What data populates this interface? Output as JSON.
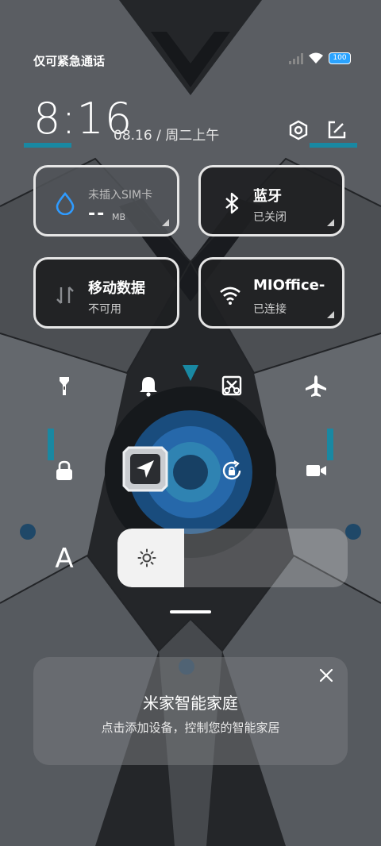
{
  "status_bar": {
    "carrier_text": "仅可紧急通话",
    "battery_text": "100",
    "icons": [
      "signal-icon",
      "wifi-icon",
      "battery-icon"
    ]
  },
  "header": {
    "time": "8:16",
    "date": "08.16 / 周二上午",
    "actions": [
      "settings-icon",
      "edit-icon"
    ]
  },
  "tiles": {
    "sim": {
      "label": "未插入SIM卡",
      "value": "--",
      "unit": "MB",
      "icon": "water-drop-icon",
      "accent": "#2f9bff"
    },
    "bluetooth": {
      "label": "蓝牙",
      "status": "已关闭",
      "icon": "bluetooth-icon"
    },
    "mobile_data": {
      "label": "移动数据",
      "status": "不可用",
      "icon": "data-arrows-icon"
    },
    "wifi": {
      "label": "MIOffice-",
      "status": "已连接",
      "icon": "wifi-icon"
    }
  },
  "toggles_row1": [
    "flashlight-icon",
    "bell-icon",
    "screenshot-icon",
    "airplane-icon"
  ],
  "toggles_row2": [
    "lock-icon",
    "location-icon",
    "rotation-lock-icon",
    "video-camera-icon"
  ],
  "brightness": {
    "auto_label": "A",
    "level": 0.29,
    "icon": "sun-icon"
  },
  "smart_home": {
    "title": "米家智能家庭",
    "subtitle": "点击添加设备，控制您的智能家居"
  },
  "colors": {
    "tile_border": "#e6e6e6",
    "accent_blue": "#2f9bff",
    "wallpaper_base": "#3a3d42"
  }
}
